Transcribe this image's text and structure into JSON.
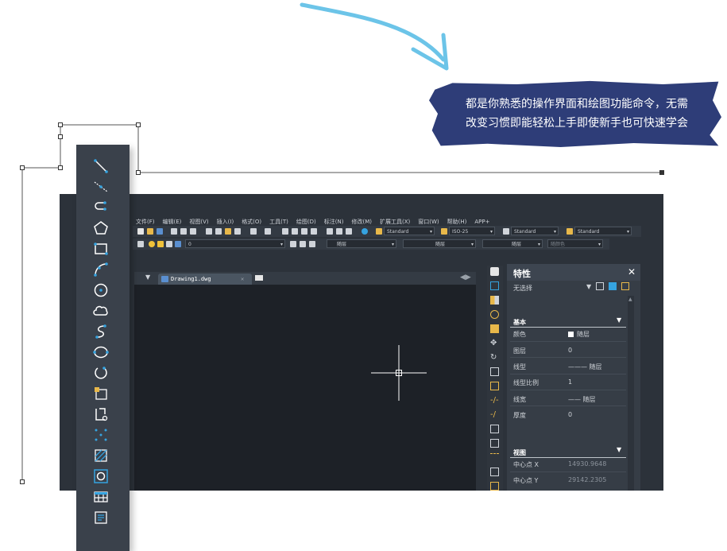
{
  "callout": {
    "line1": "都是你熟悉的操作界面和绘图功能命令，无需",
    "line2": "改变习惯即能轻松上手即使新手也可快速学会"
  },
  "left_toolbar": {
    "icons": [
      "line-icon",
      "construction-line-icon",
      "polyline-icon",
      "polygon-icon",
      "rectangle-icon",
      "arc-icon",
      "circle-icon",
      "revision-cloud-icon",
      "spline-icon",
      "ellipse-icon",
      "ellipse-arc-icon",
      "insert-block-icon",
      "create-block-icon",
      "point-icon",
      "hatch-icon",
      "region-icon",
      "table-icon",
      "multiline-text-icon"
    ]
  },
  "menu": [
    "文件(F)",
    "编辑(E)",
    "视图(V)",
    "插入(I)",
    "格式(O)",
    "工具(T)",
    "绘图(D)",
    "标注(N)",
    "修改(M)",
    "扩展工具(X)",
    "窗口(W)",
    "帮助(H)",
    "APP+"
  ],
  "toolbar": {
    "text_style": "Standard",
    "dim_style": "ISO-25",
    "table_style": "Standard",
    "multileader_style": "Standard",
    "layer": "0",
    "color": "随层",
    "linetype": "随层",
    "lineweight": "随层",
    "plot_style": "随颜色"
  },
  "document": {
    "tab_name": "Drawing1.dwg"
  },
  "properties": {
    "title": "特性",
    "close": "✕",
    "selection": "无选择",
    "section_basic": "基本",
    "rows": [
      {
        "label": "颜色",
        "value": "随层"
      },
      {
        "label": "图层",
        "value": "0"
      },
      {
        "label": "线型",
        "value": "——— 随层"
      },
      {
        "label": "线型比例",
        "value": "1"
      },
      {
        "label": "线宽",
        "value": "—— 随层"
      },
      {
        "label": "厚度",
        "value": "0"
      }
    ],
    "section_view": "视图",
    "view_rows": [
      {
        "label": "中心点 X",
        "value": "14930.9648"
      },
      {
        "label": "中心点 Y",
        "value": "29142.2305"
      }
    ]
  },
  "colors": {
    "accent_blue": "#35a3e0",
    "callout_bg": "#2e3d78",
    "arrow": "#6cc4e8"
  }
}
